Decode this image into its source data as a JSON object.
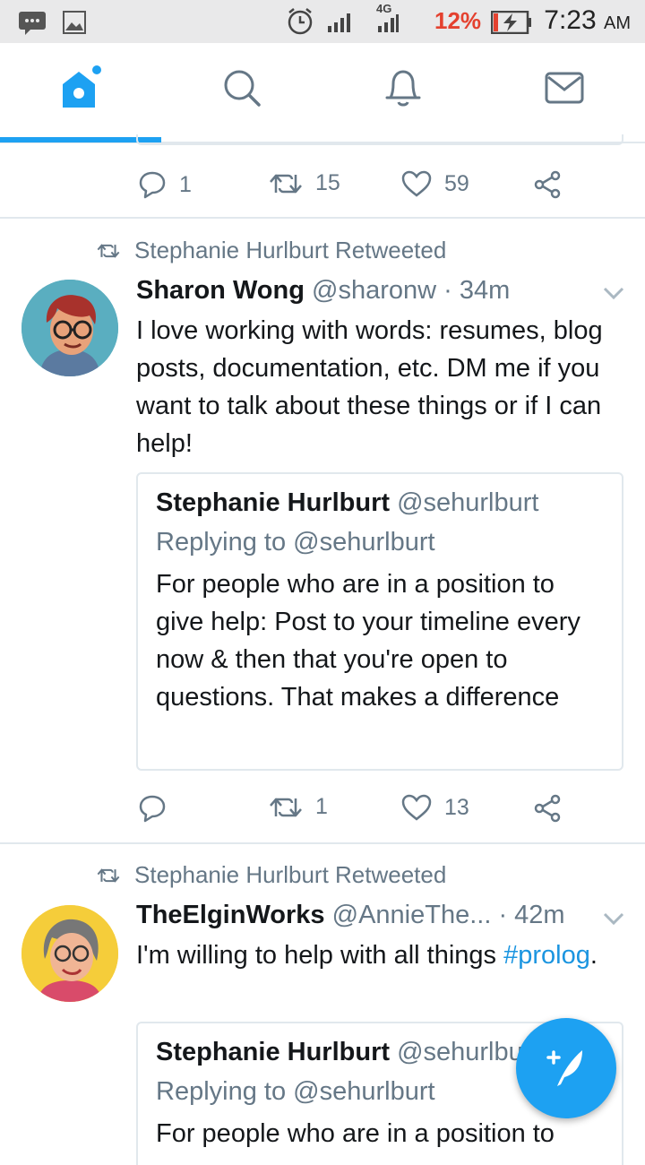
{
  "status_bar": {
    "time": "7:23",
    "ampm": "AM",
    "battery": "12%",
    "network": "4G",
    "accent": "#e4412f"
  },
  "tabs": [
    {
      "name": "home",
      "icon": "home-icon",
      "active": true
    },
    {
      "name": "search",
      "icon": "search-icon",
      "active": false
    },
    {
      "name": "notifications",
      "icon": "bell-icon",
      "active": false
    },
    {
      "name": "messages",
      "icon": "mail-icon",
      "active": false
    }
  ],
  "brand_color": "#1da1f2",
  "prev_tweet_actions": {
    "replies": "1",
    "retweets": "15",
    "likes": "59"
  },
  "tweets": [
    {
      "retweeted_by": "Stephanie Hurlburt Retweeted",
      "name": "Sharon Wong",
      "handle": "@sharonw",
      "time": "· 34m",
      "text": "I love working with words: resumes, blog posts, documentation, etc. DM me if you want to talk about these things or if I can help!",
      "quote": {
        "name": "Stephanie Hurlburt",
        "handle": "@sehurlburt",
        "replying": "Replying to @sehurlburt",
        "text": "For people who are in a position to give help: Post to your timeline every now & then that you're open to questions. That makes a difference"
      },
      "actions": {
        "replies": "",
        "retweets": "1",
        "likes": "13"
      }
    },
    {
      "retweeted_by": "Stephanie Hurlburt Retweeted",
      "name": "TheElginWorks",
      "handle": "@AnnieThe...",
      "time": "· 42m",
      "text_before": "I'm willing to help with all things ",
      "hashtag": "#prolog",
      "text_after": ".",
      "quote": {
        "name": "Stephanie Hurlburt",
        "handle": "@sehurlburt",
        "replying": "Replying to @sehurlburt",
        "text": "For people who are in a position to"
      }
    }
  ]
}
